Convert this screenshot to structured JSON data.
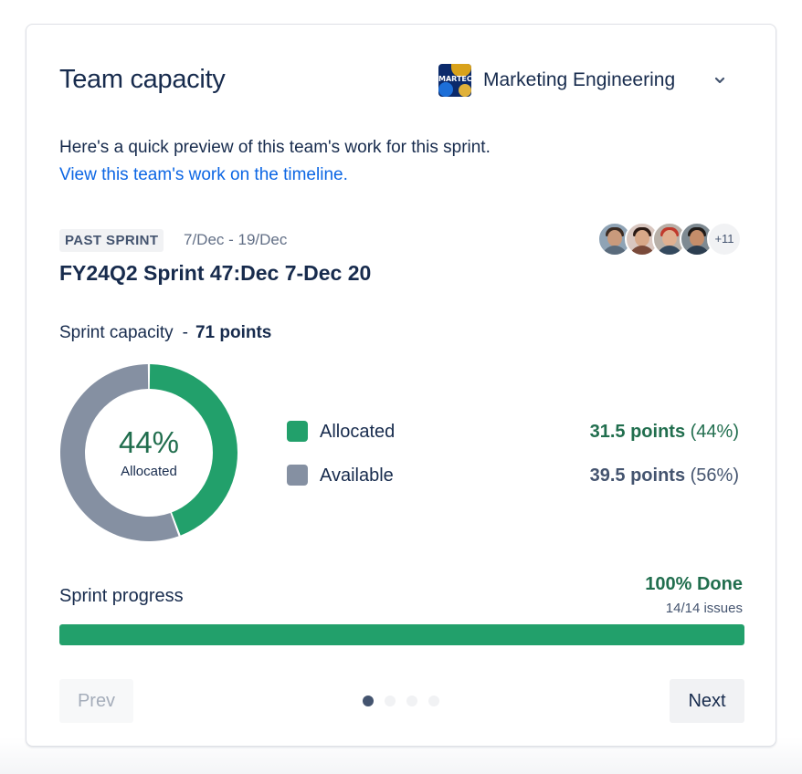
{
  "card": {
    "title": "Team capacity",
    "team": {
      "name": "Marketing Engineering",
      "avatar_text": "MARTECH E",
      "avatar_icon": "team-avatar-icon"
    },
    "description": "Here's a quick preview of this team's work for this sprint.",
    "timeline_link": "View this team's work on the timeline."
  },
  "sprint": {
    "status": "PAST SPRINT",
    "dates": "7/Dec - 19/Dec",
    "name": "FY24Q2 Sprint 47:Dec 7-Dec 20",
    "members_more": "+11",
    "member_count_shown": 4
  },
  "capacity": {
    "label": "Sprint capacity",
    "separator": "-",
    "total": "71 points",
    "donut_percent": "44%",
    "donut_caption": "Allocated"
  },
  "chart_data": {
    "type": "pie",
    "style": "donut",
    "categories": [
      "Allocated",
      "Available"
    ],
    "values": [
      31.5,
      39.5
    ],
    "percent": [
      44,
      56
    ],
    "colors": [
      "#22a06b",
      "#8590a2"
    ]
  },
  "legend": [
    {
      "label": "Allocated",
      "value": "31.5 points",
      "pct": "(44%)",
      "color": "#22a06b",
      "value_color": "#216e4e"
    },
    {
      "label": "Available",
      "value": "39.5 points",
      "pct": "(56%)",
      "color": "#8590a2",
      "value_color": "#44546f"
    }
  ],
  "progress": {
    "label": "Sprint progress",
    "done_text": "100% Done",
    "issues_text": "14/14 issues",
    "fraction": 1.0
  },
  "pager": {
    "prev_label": "Prev",
    "next_label": "Next",
    "pages": 4,
    "active_page": 1
  }
}
